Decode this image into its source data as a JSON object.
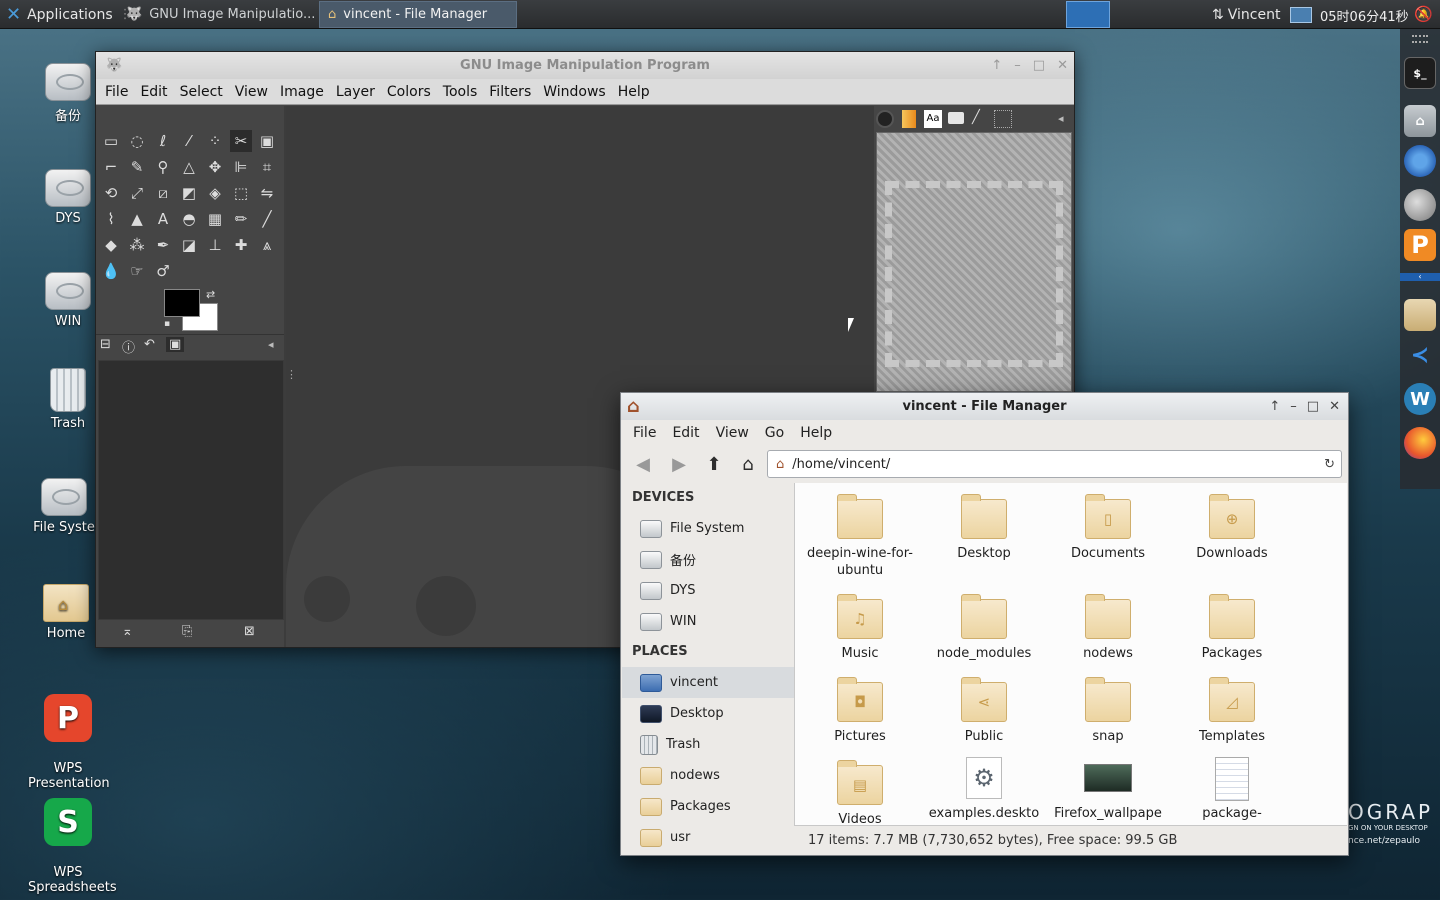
{
  "taskbar": {
    "apps_label": "Applications",
    "tasks": [
      {
        "label": "GNU Image Manipulatio..."
      },
      {
        "label": "vincent - File Manager"
      }
    ],
    "user": "Vincent",
    "clock": "05时06分41秒"
  },
  "desktop_icons": [
    {
      "label": "备份"
    },
    {
      "label": "DYS"
    },
    {
      "label": "WIN"
    },
    {
      "label": "Trash"
    },
    {
      "label": "File Syste"
    },
    {
      "label": "Home"
    },
    {
      "label": "WPS\nPresentation"
    },
    {
      "label": "WPS\nSpreadsheets"
    }
  ],
  "wallpaper_text": {
    "line1": "OGRAP",
    "line2": "GN ON YOUR DESKTOP",
    "line3": "nce.net/zepaulo"
  },
  "gimp": {
    "title": "GNU Image Manipulation Program",
    "menu": [
      "File",
      "Edit",
      "Select",
      "View",
      "Image",
      "Layer",
      "Colors",
      "Tools",
      "Filters",
      "Windows",
      "Help"
    ]
  },
  "file_manager": {
    "title": "vincent - File Manager",
    "menu": [
      "File",
      "Edit",
      "View",
      "Go",
      "Help"
    ],
    "location": "/home/vincent/",
    "sidebar": {
      "devices_header": "DEVICES",
      "devices": [
        {
          "label": "File System"
        },
        {
          "label": "备份"
        },
        {
          "label": "DYS"
        },
        {
          "label": "WIN"
        }
      ],
      "places_header": "PLACES",
      "places": [
        {
          "label": "vincent"
        },
        {
          "label": "Desktop"
        },
        {
          "label": "Trash"
        },
        {
          "label": "nodews"
        },
        {
          "label": "Packages"
        },
        {
          "label": "usr"
        }
      ]
    },
    "files": [
      {
        "name": "deepin-wine-for-ubuntu",
        "icon": "folder"
      },
      {
        "name": "Desktop",
        "icon": "folder"
      },
      {
        "name": "Documents",
        "icon": "folder-documents"
      },
      {
        "name": "Downloads",
        "icon": "folder-download"
      },
      {
        "name": "Music",
        "icon": "folder-music"
      },
      {
        "name": "node_modules",
        "icon": "folder"
      },
      {
        "name": "nodews",
        "icon": "folder"
      },
      {
        "name": "Packages",
        "icon": "folder"
      },
      {
        "name": "Pictures",
        "icon": "folder-pictures"
      },
      {
        "name": "Public",
        "icon": "folder-publicshare"
      },
      {
        "name": "snap",
        "icon": "folder"
      },
      {
        "name": "Templates",
        "icon": "folder-templates"
      },
      {
        "name": "Videos",
        "icon": "folder-videos"
      },
      {
        "name": "examples.deskto",
        "icon": "settings-file"
      },
      {
        "name": "Firefox_wallpape",
        "icon": "image-file"
      },
      {
        "name": "package-",
        "icon": "text-file"
      }
    ],
    "status": "17 items: 7.7 MB (7,730,652 bytes), Free space: 99.5 GB"
  }
}
